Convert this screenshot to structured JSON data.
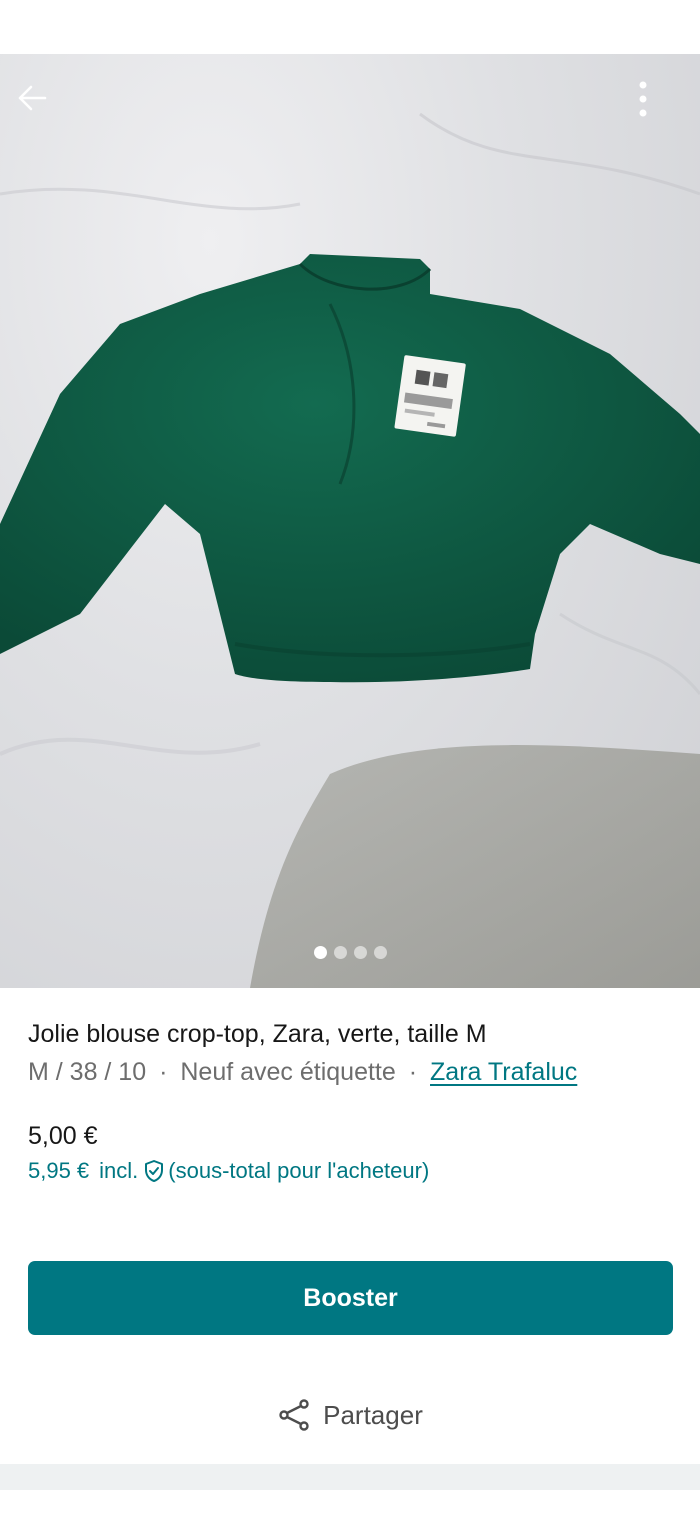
{
  "header": {
    "back_icon": "arrow-left-icon",
    "more_icon": "more-vertical-icon"
  },
  "gallery": {
    "photo_count": 4,
    "active_index": 0
  },
  "item": {
    "title": "Jolie blouse crop-top, Zara, verte, taille M",
    "size": "M / 38 / 10",
    "separator": "·",
    "condition": "Neuf avec étiquette",
    "brand": "Zara Trafaluc",
    "price": "5,00 €",
    "buyer_price": "5,95 €",
    "buyer_price_incl": "incl.",
    "buyer_price_note": "(sous-total pour l'acheteur)"
  },
  "actions": {
    "booster_label": "Booster",
    "share_label": "Partager",
    "share_icon": "share-icon"
  },
  "colors": {
    "accent": "#007782",
    "blouse": "#0f5a43",
    "background": "#ffffff"
  }
}
